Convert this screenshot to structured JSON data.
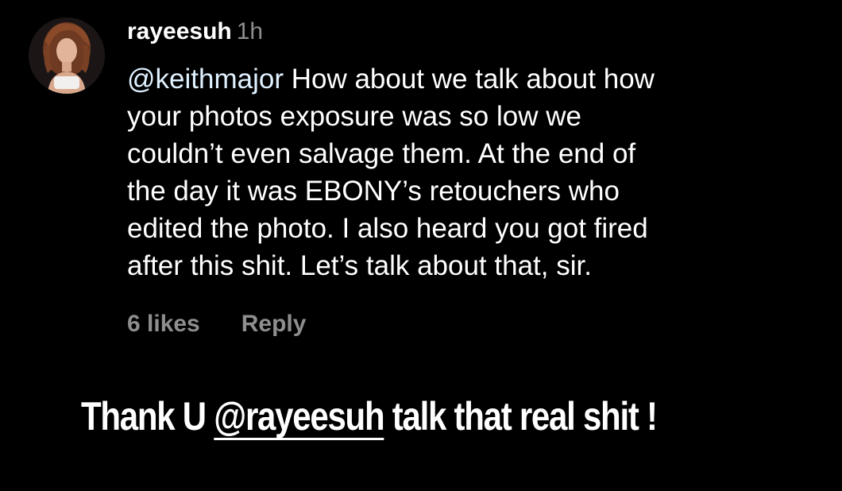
{
  "comment": {
    "username": "rayeesuh",
    "time": "1h",
    "mention": "@keithmajor",
    "lines": [
      " How about we talk about how",
      "your photos exposure was so low we",
      "couldn’t even salvage them. At the end of",
      "the day it was EBONY’s retouchers who",
      "edited the photo. I also heard you got fired",
      "after this shit. Let’s talk about that, sir."
    ],
    "likes": "6 likes",
    "reply": "Reply"
  },
  "caption": {
    "before": "Thank U ",
    "handle": "@rayeesuh",
    "after": " talk that real shit !"
  },
  "colors": {
    "background": "#000000",
    "text": "#ffffff",
    "muted": "#8e8e8e",
    "mention": "#e0f1ff"
  }
}
